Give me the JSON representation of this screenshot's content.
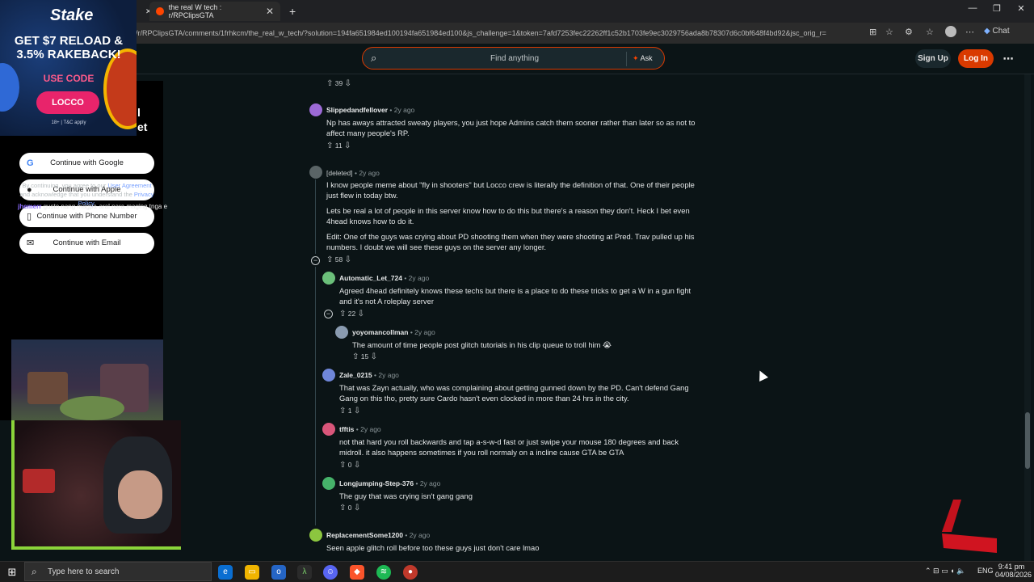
{
  "browser": {
    "tabs": [
      {
        "title": "the real W tech : r/RPClipsGTA",
        "active": true
      }
    ],
    "new_tab": "+",
    "url": "/r/RPClipsGTA/comments/1frhkcm/the_real_w_tech/?solution=194fa651984ed100194fa651984ed100&js_challenge=1&token=7afd7253fec22262ff1c52b1703fe9ec3029756ada8b78307d6c0bf648f4bd92&jsc_orig_r=",
    "chat_label": "Chat"
  },
  "reddit": {
    "search_placeholder": "Find anything",
    "ask_label": "Ask",
    "signup_label": "Sign Up",
    "login_label": "Log In",
    "more_icon": "⋯"
  },
  "login_panel": {
    "title_fragment_1": "l",
    "title_fragment_2": "et",
    "google_label": "Continue with Google",
    "apple_label": "Continue with Apple",
    "phone_label": "Continue with Phone Number",
    "email_label": "Continue with Email",
    "terms_prefix": "By continuing, you agree to our ",
    "terms_link1": "User Agreement",
    "terms_mid": " and acknowledge that you understand the ",
    "terms_link2": "Privacy Policy",
    "terms_end": "."
  },
  "stream_overlay": {
    "chat_user": "jhemerr",
    "chat_text": "gusto nang magpa-aral para maging tnga e",
    "ad_brand": "Stake",
    "ad_promo": "GET $7 RELOAD & 3.5% RAKEBACK!",
    "ad_usecode": "USE CODE",
    "ad_code": "LOCCO",
    "ad_tc": "18+ | T&C apply"
  },
  "comments": [
    {
      "id": "top-partial",
      "votes": "39"
    },
    {
      "id": "slippedandfellover",
      "user": "Slippedandfellover",
      "time": "2y ago",
      "avatar_color": "#9c6ad6",
      "lines": [
        "Np has aways attracted sweaty players, you just hope Admins catch them sooner rather than later so as not to",
        "affect many people's RP."
      ],
      "votes": "11"
    },
    {
      "id": "deleted",
      "user": "[deleted]",
      "time": "2y ago",
      "avatar_color": "#9aa3a6",
      "para1": [
        "I know people meme about \"fly in shooters\" but Locco crew is literally the definition of that. One of their people",
        "just flew in today btw."
      ],
      "para2": [
        "Lets be real a lot of people in this server know how to do this but there's a reason they don't. Heck I bet even",
        "4head knows how to do it."
      ],
      "para3": [
        "Edit: One of the guys was crying about PD shooting them when they were shooting at Pred. Trav pulled up his",
        "numbers. I doubt we will see these guys on the server any longer."
      ],
      "votes": "58"
    },
    {
      "id": "automatic",
      "user": "Automatic_Let_724",
      "time": "2y ago",
      "avatar_color": "#6bbf7a",
      "lines": [
        "Agreed 4head definitely knows these techs but there is a place to do these tricks to get a W in a gun fight",
        "and it's not A roleplay server"
      ],
      "votes": "22"
    },
    {
      "id": "yoyoman",
      "user": "yoyomancollman",
      "time": "2y ago",
      "avatar_color": "#8a9bb0",
      "lines": [
        "The amount of time people post glitch tutorials in his clip queue to troll him 😭"
      ],
      "votes": "15"
    },
    {
      "id": "zale",
      "user": "Zale_0215",
      "time": "2y ago",
      "avatar_color": "#6f86d9",
      "lines": [
        "That was Zayn actually, who was complaining about getting gunned down by the PD. Can't defend Gang",
        "Gang on this tho, pretty sure Cardo hasn't even clocked in more than 24 hrs in the city."
      ],
      "votes": "1"
    },
    {
      "id": "tfftis",
      "user": "tfftis",
      "time": "2y ago",
      "avatar_color": "#d9567a",
      "lines": [
        "not that hard you roll backwards and tap a-s-w-d fast or just swipe your mouse 180 degrees and back",
        "midroll. it also happens sometimes if you roll normaly on a incline cause GTA be GTA"
      ],
      "votes": "0"
    },
    {
      "id": "longjumping",
      "user": "Longjumping-Step-376",
      "time": "2y ago",
      "avatar_color": "#46b36a",
      "lines": [
        "The guy that was crying isn't gang gang"
      ],
      "votes": "0"
    },
    {
      "id": "replacement",
      "user": "ReplacementSome1200",
      "time": "2y ago",
      "avatar_color": "#8cc63f",
      "lines": [
        "Seen apple glitch roll before too these guys just don't care lmao"
      ]
    }
  ],
  "taskbar": {
    "search_placeholder": "Type here to search",
    "lang": "ENG",
    "time": "9:41 pm",
    "date": "04/08/2026"
  }
}
